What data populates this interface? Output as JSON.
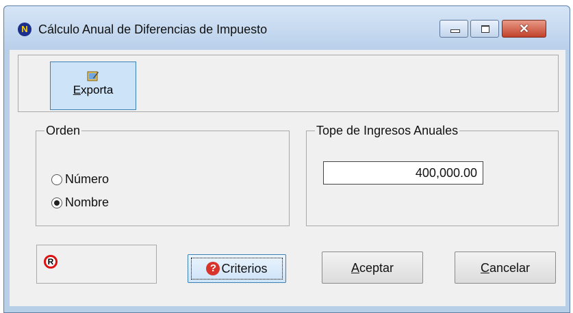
{
  "window": {
    "title": "Cálculo Anual de Diferencias de Impuesto",
    "app_icon_letter": "N"
  },
  "toolbar": {
    "export_label_underlined": "E",
    "export_label_rest": "xporta"
  },
  "orden": {
    "legend": "Orden",
    "options": [
      {
        "label": "Número",
        "checked": false
      },
      {
        "label": "Nombre",
        "checked": true
      }
    ]
  },
  "tope": {
    "legend": "Tope de Ingresos Anuales",
    "value": "400,000.00"
  },
  "buttons": {
    "r_icon": "R",
    "criterios": "Criterios",
    "aceptar_underlined": "A",
    "aceptar_rest": "ceptar",
    "cancelar_underlined": "C",
    "cancelar_rest": "ancelar"
  }
}
